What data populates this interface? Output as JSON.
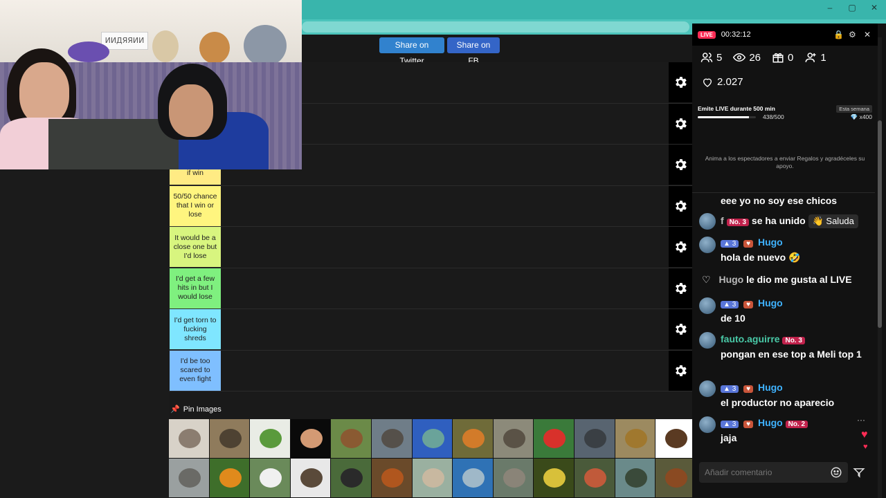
{
  "window": {
    "controls": [
      "–",
      "▢",
      "✕"
    ]
  },
  "share": {
    "twitter_label": "Share on Twitter",
    "fb_label": "Share on FB"
  },
  "webcam": {
    "sign_text": "ИИДЯЯИИ"
  },
  "tiers": [
    {
      "label": "",
      "color": "#1a1a1a"
    },
    {
      "label": "",
      "color": "#1a1a1a"
    },
    {
      "label": "close one but if win",
      "color": "#ffeb84"
    },
    {
      "label": "50/50 chance that I win or lose",
      "color": "#fff57f"
    },
    {
      "label": "It would be a close one but I'd lose",
      "color": "#d8f57f"
    },
    {
      "label": "I'd get a few hits in but I would lose",
      "color": "#7ff07f"
    },
    {
      "label": "I'd get torn to fucking shreds",
      "color": "#7fe6ff"
    },
    {
      "label": "I'd be too scared to even fight",
      "color": "#7fbfff"
    }
  ],
  "pin": {
    "label": "Pin Images"
  },
  "animal_images": [
    "mouse",
    "deer",
    "lizard",
    "gecko",
    "bear",
    "hippo",
    "turtle",
    "tiger",
    "wolf",
    "parrot",
    "komodo-dragon",
    "lion",
    "eagle",
    "rhino",
    "oriole",
    "panda",
    "ferret",
    "gorilla",
    "orangutan",
    "llama",
    "shark",
    "elephant",
    "snake",
    "starfish",
    "alligator",
    "horse"
  ],
  "live": {
    "badge": "LIVE",
    "timer": "00:32:12",
    "stats": {
      "viewers_joined": "5",
      "views": "26",
      "gifts": "0",
      "new_followers": "1",
      "likes": "2.027"
    },
    "goal": {
      "title": "Emite LIVE durante 500 min",
      "period": "Esta semana",
      "progress_text": "438/500",
      "progress_fraction": 0.876,
      "reward": "x400"
    },
    "hint": "Anima a los espectadores a enviar Regalos y agradéceles su apoyo.",
    "chat": [
      {
        "type": "text",
        "text": "eee yo no soy ese chicos"
      },
      {
        "type": "join",
        "user": "f",
        "rank": "No. 3",
        "text": "se ha unido",
        "action": "Saluda"
      },
      {
        "type": "msg",
        "level": "3",
        "user": "Hugo",
        "text": "hola de nuevo 🤣"
      },
      {
        "type": "like",
        "user": "Hugo",
        "text": "le dio me gusta al LIVE"
      },
      {
        "type": "msg",
        "level": "3",
        "user": "Hugo",
        "text": "de 10"
      },
      {
        "type": "msg2",
        "user": "fauto.aguirre",
        "rank": "No. 3",
        "text": "pongan en ese top a Meli top 1"
      },
      {
        "type": "msg",
        "level": "3",
        "user": "Hugo",
        "text": "el productor no aparecio"
      },
      {
        "type": "msg3",
        "level": "3",
        "user": "Hugo",
        "rank": "No. 2",
        "text": "jaja"
      }
    ],
    "comment_placeholder": "Añadir comentario",
    "more": "···"
  }
}
